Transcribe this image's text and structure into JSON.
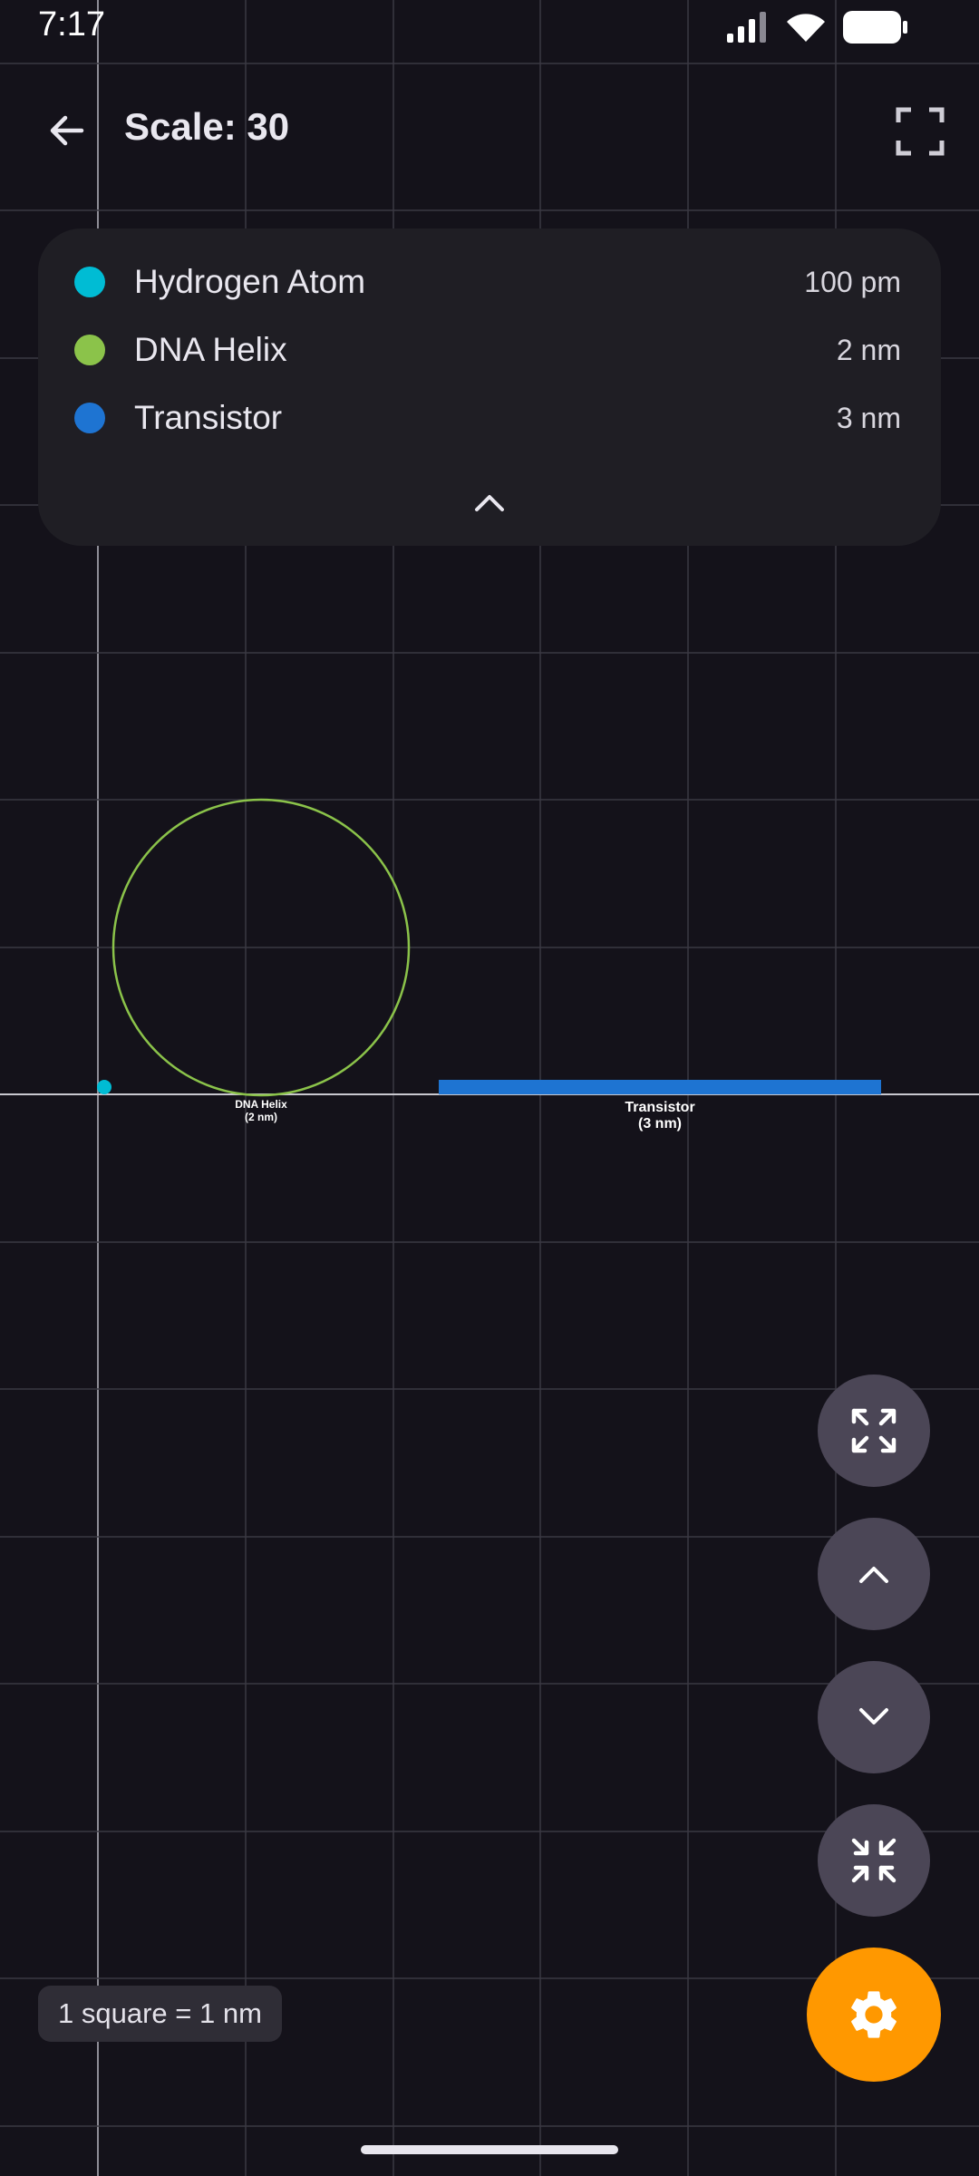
{
  "status": {
    "time": "7:17"
  },
  "header": {
    "title": "Scale: 30"
  },
  "legend": {
    "items": [
      {
        "name": "Hydrogen Atom",
        "size": "100 pm",
        "color": "#00bcd4"
      },
      {
        "name": "DNA Helix",
        "size": "2 nm",
        "color": "#8bc34a"
      },
      {
        "name": "Transistor",
        "size": "3 nm",
        "color": "#1e74d2"
      }
    ]
  },
  "diagram": {
    "dna_label": "DNA Helix",
    "dna_sub": "(2 nm)",
    "transistor_label": "Transistor",
    "transistor_sub": "(3 nm)"
  },
  "footer": {
    "scale_note": "1 square = 1 nm"
  },
  "colors": {
    "accent": "#ff9800",
    "fab": "#4b4656",
    "grid": "#3a3942"
  },
  "icons": [
    "back-arrow-icon",
    "fullscreen-icon",
    "chevron-up-icon",
    "expand-arrows-icon",
    "chevron-down-icon",
    "collapse-arrows-icon",
    "gear-icon"
  ]
}
